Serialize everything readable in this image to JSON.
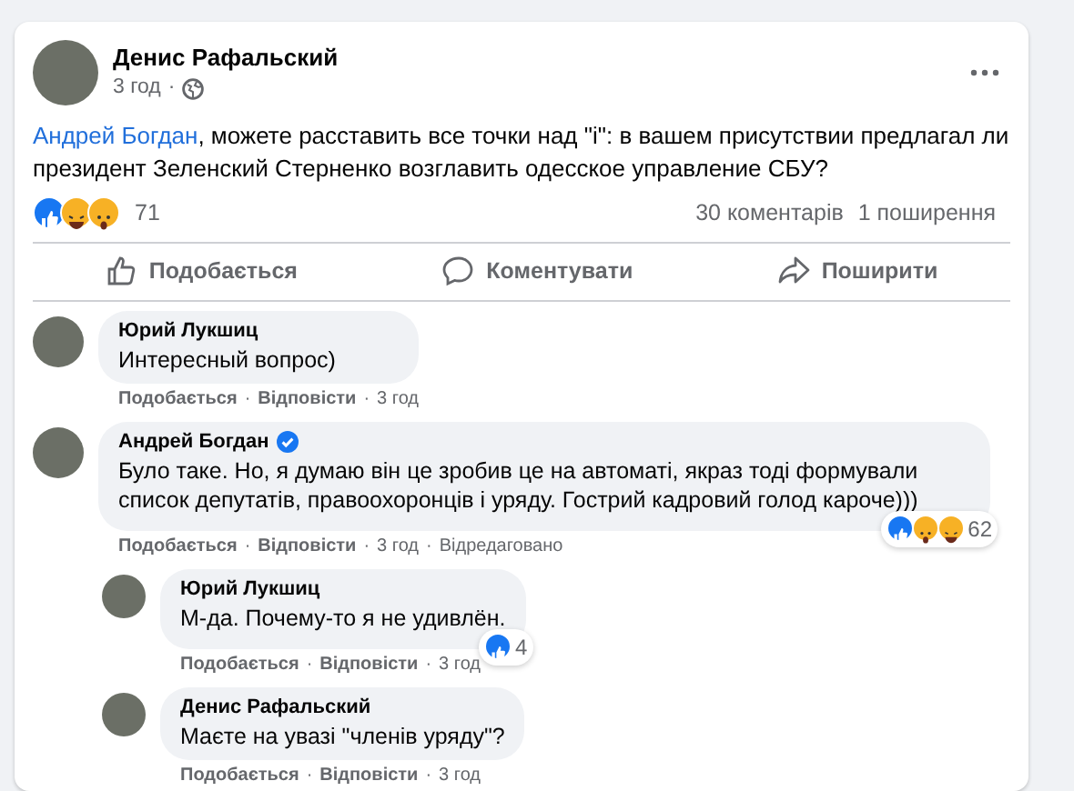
{
  "post": {
    "author": "Денис Рафальский",
    "time": "3 год",
    "separator": "·",
    "mention": "Андрей Богдан",
    "text": ", можете расставить все точки над \"і\": в вашем присутствии предлагал ли президент Зеленский Стерненко возглавить одесское управление СБУ?",
    "reactions": [
      {
        "kind": "like"
      },
      {
        "kind": "haha"
      },
      {
        "kind": "wow"
      }
    ],
    "reaction_count": "71",
    "comments_count": "30 коментарів",
    "shares_count": "1 поширення",
    "actions": [
      {
        "kind": "like",
        "label": "Подобається"
      },
      {
        "kind": "comment",
        "label": "Коментувати"
      },
      {
        "kind": "share",
        "label": "Поширити"
      }
    ]
  },
  "comments": [
    {
      "author": "Юрий Лукшиц",
      "verified": false,
      "text": "Интересный вопрос)",
      "meta": [
        "Подобається",
        "Відповісти",
        "3 год"
      ]
    },
    {
      "author": "Андрей Богдан",
      "verified": true,
      "text": "Було таке. Но, я думаю він це зробив це на автоматі, якраз тоді формували список депутатів, правоохоронців і уряду. Гострий кадровий голод кароче)))",
      "reactions": [
        {
          "kind": "like"
        },
        {
          "kind": "wow"
        },
        {
          "kind": "haha"
        }
      ],
      "reaction_count": "62",
      "meta": [
        "Подобається",
        "Відповісти",
        "3 год",
        "Відредаговано"
      ],
      "children": [
        {
          "author": "Юрий Лукшиц",
          "verified": false,
          "text": "М-да. Почему-то я не удивлён.",
          "reactions": [
            {
              "kind": "like"
            }
          ],
          "reaction_count": "4",
          "meta": [
            "Подобається",
            "Відповісти",
            "3 год"
          ]
        },
        {
          "author": "Денис Рафальский",
          "verified": false,
          "text": "Маєте на увазі \"членів уряду\"?",
          "meta": [
            "Подобається",
            "Відповісти",
            "3 год"
          ]
        }
      ]
    }
  ]
}
